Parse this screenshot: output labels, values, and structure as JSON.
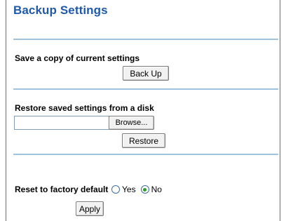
{
  "page": {
    "title": "Backup Settings"
  },
  "backup": {
    "label": "Save a copy of current settings",
    "button": "Back Up"
  },
  "restore": {
    "label": "Restore saved settings from a disk",
    "file_value": "",
    "browse_button": "Browse...",
    "restore_button": "Restore"
  },
  "reset": {
    "label": "Reset to factory default",
    "options": [
      {
        "label": "Yes",
        "checked": false
      },
      {
        "label": "No",
        "checked": true
      }
    ],
    "apply_button": "Apply"
  },
  "colors": {
    "title": "#1f5aa8",
    "separator": "#9ec3e0",
    "radio_selected": "#2d9a2d"
  }
}
